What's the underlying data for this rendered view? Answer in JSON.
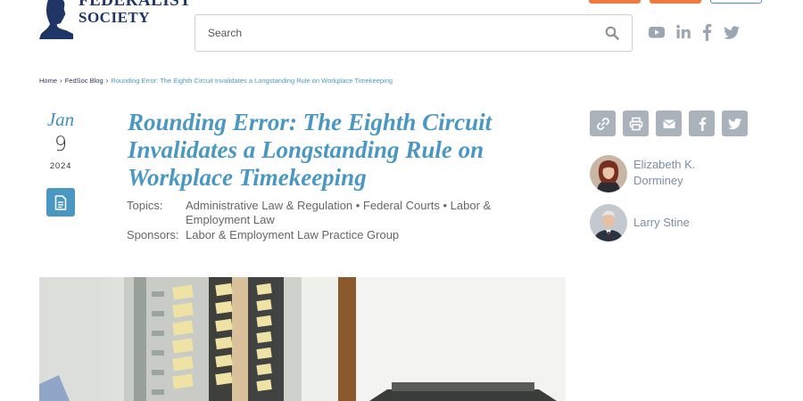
{
  "header": {
    "logo_line1": "FEDERALIST",
    "logo_line2": "SOCIETY",
    "search": {
      "placeholder": "Search"
    },
    "social": [
      "youtube-icon",
      "linkedin-icon",
      "facebook-icon",
      "twitter-icon"
    ]
  },
  "breadcrumb": {
    "items": [
      "Home",
      "FedSoc Blog"
    ],
    "current": "Rounding Error: The Eighth Circuit Invalidates a Longstanding Rule on Workplace Timekeeping"
  },
  "article": {
    "date": {
      "month": "Jan",
      "day": "9",
      "year": "2024"
    },
    "title": "Rounding Error: The Eighth Circuit Invalidates a Longstanding Rule on Workplace Timekeeping",
    "topics_label": "Topics:",
    "topics": "Administrative Law & Regulation • Federal Courts • Labor & Employment Law",
    "sponsors_label": "Sponsors:",
    "sponsors": "Labor & Employment Law Practice Group"
  },
  "share_icons": [
    "link-icon",
    "print-icon",
    "email-icon",
    "facebook-icon",
    "twitter-icon"
  ],
  "authors": [
    {
      "name": "Elizabeth K. Dorminey"
    },
    {
      "name": "Larry Stine"
    }
  ],
  "colors": {
    "brand_navy": "#1f3566",
    "accent_blue": "#4a98c1",
    "orange": "#f07a3d",
    "share_gray": "#aab3bc"
  }
}
